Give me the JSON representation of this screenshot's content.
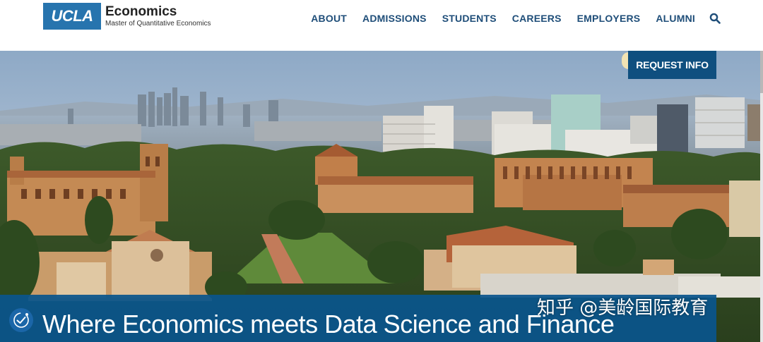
{
  "brand": {
    "logo_text": "UCLA",
    "title": "Economics",
    "subtitle": "Master of Quantitative Economics",
    "color": "#2774ae"
  },
  "nav": {
    "items": [
      {
        "label": "ABOUT"
      },
      {
        "label": "ADMISSIONS"
      },
      {
        "label": "STUDENTS"
      },
      {
        "label": "CAREERS"
      },
      {
        "label": "EMPLOYERS"
      },
      {
        "label": "ALUMNI"
      }
    ],
    "search_icon": "search-icon",
    "color": "#1f4e79"
  },
  "hero": {
    "request_info_label": "REQUEST INFO",
    "headline": "Where Economics meets Data Science and Finance",
    "accessibility_icon": "accessibility-icon",
    "banner_color": "#0a558c",
    "button_color": "#0f4f7f"
  },
  "watermark": {
    "text": "知乎 @美龄国际教育"
  }
}
